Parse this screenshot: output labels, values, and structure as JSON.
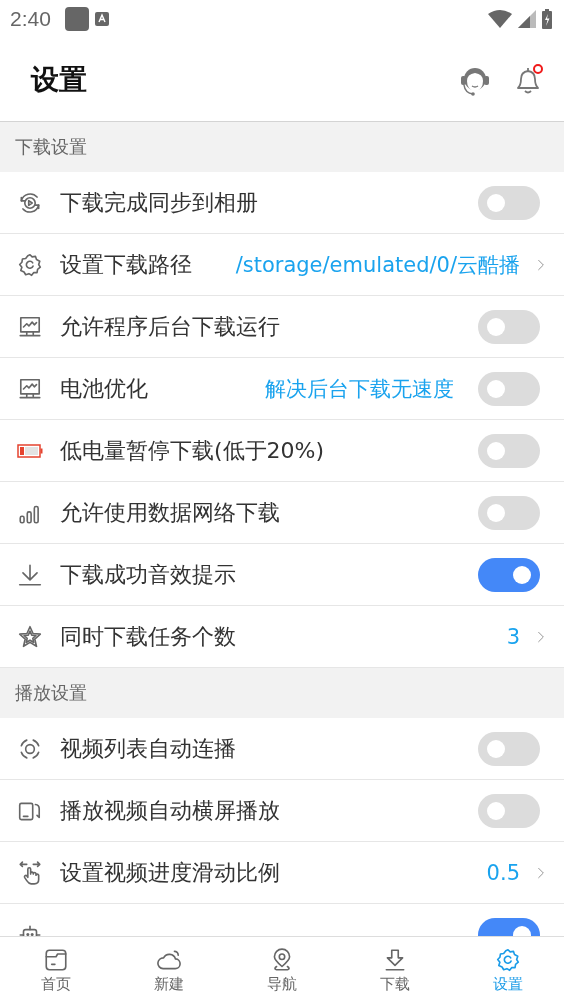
{
  "status_bar": {
    "time": "2:40"
  },
  "header": {
    "title": "设置",
    "notification_dot": true
  },
  "sections": [
    {
      "title": "下载设置",
      "items": [
        {
          "kind": "toggle",
          "label": "下载完成同步到相册",
          "on": false
        },
        {
          "kind": "link",
          "label": "设置下载路径",
          "value": "/storage/emulated/0/云酷播"
        },
        {
          "kind": "toggle",
          "label": "允许程序后台下载运行",
          "on": false
        },
        {
          "kind": "toggle",
          "label": "电池优化",
          "note": "解决后台下载无速度",
          "on": false
        },
        {
          "kind": "toggle",
          "label": "低电量暂停下载(低于20%)",
          "on": false
        },
        {
          "kind": "toggle",
          "label": "允许使用数据网络下载",
          "on": false
        },
        {
          "kind": "toggle",
          "label": "下载成功音效提示",
          "on": true
        },
        {
          "kind": "link",
          "label": "同时下载任务个数",
          "value": "3"
        }
      ]
    },
    {
      "title": "播放设置",
      "items": [
        {
          "kind": "toggle",
          "label": "视频列表自动连播",
          "on": false
        },
        {
          "kind": "toggle",
          "label": "播放视频自动横屏播放",
          "on": false
        },
        {
          "kind": "link",
          "label": "设置视频进度滑动比例",
          "value": "0.5"
        },
        {
          "kind": "toggle",
          "on": true
        }
      ]
    }
  ],
  "tabs": [
    {
      "label": "首页",
      "selected": false
    },
    {
      "label": "新建",
      "selected": false
    },
    {
      "label": "导航",
      "selected": false
    },
    {
      "label": "下载",
      "selected": false
    },
    {
      "label": "设置",
      "selected": true
    }
  ]
}
